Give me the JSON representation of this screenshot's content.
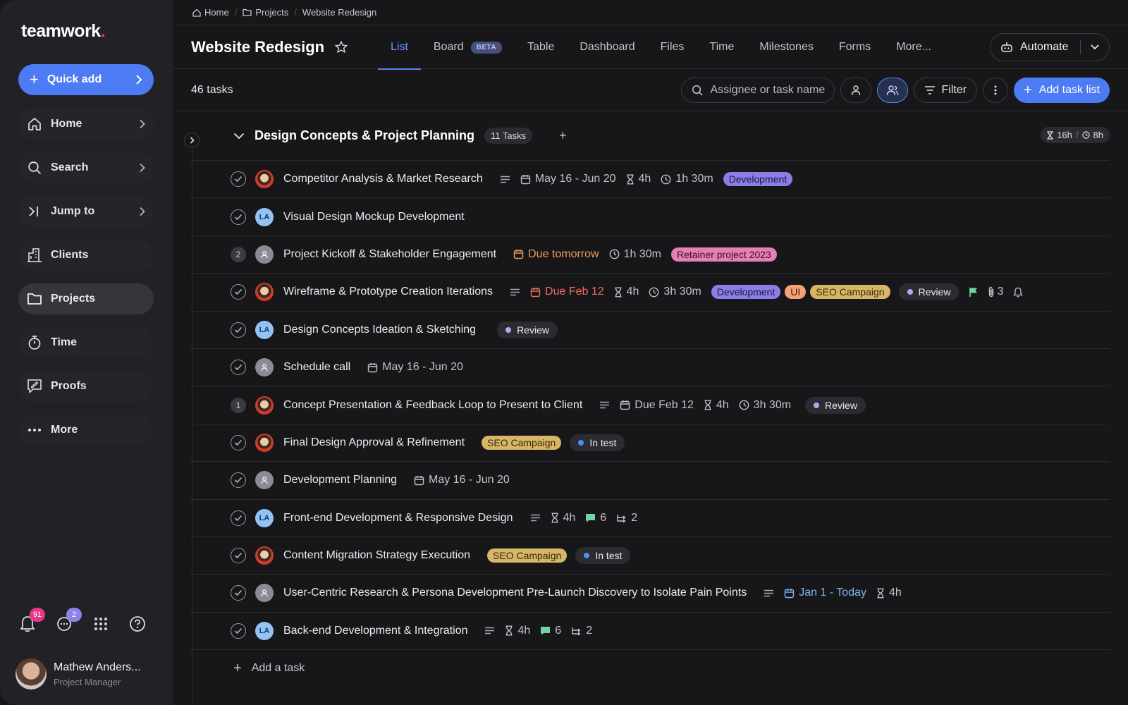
{
  "app": {
    "logo_text": "teamwork",
    "logo_dot": ".",
    "brand_color": "#4d7bf3"
  },
  "sidebar": {
    "quick_add_label": "Quick add",
    "items": [
      {
        "label": "Home",
        "icon": "home-icon",
        "has_chevron": true,
        "active": false
      },
      {
        "label": "Search",
        "icon": "search-icon",
        "has_chevron": true,
        "active": false
      },
      {
        "label": "Jump to",
        "icon": "jump-icon",
        "has_chevron": true,
        "active": false
      },
      {
        "label": "Clients",
        "icon": "building-icon",
        "has_chevron": false,
        "active": false
      },
      {
        "label": "Projects",
        "icon": "folder-icon",
        "has_chevron": false,
        "active": true
      },
      {
        "label": "Time",
        "icon": "stopwatch-icon",
        "has_chevron": false,
        "active": false
      },
      {
        "label": "Proofs",
        "icon": "proof-icon",
        "has_chevron": false,
        "active": false
      },
      {
        "label": "More",
        "icon": "more-dots-icon",
        "has_chevron": false,
        "active": false
      }
    ],
    "notifications_count": "91",
    "chat_count": "2",
    "user": {
      "name": "Mathew Anders...",
      "role": "Project Manager"
    }
  },
  "breadcrumb": {
    "home": "Home",
    "projects": "Projects",
    "current": "Website Redesign"
  },
  "header": {
    "title": "Website Redesign",
    "tabs": [
      {
        "label": "List",
        "active": true
      },
      {
        "label": "Board",
        "badge": "BETA"
      },
      {
        "label": "Table"
      },
      {
        "label": "Dashboard"
      },
      {
        "label": "Files"
      },
      {
        "label": "Time"
      },
      {
        "label": "Milestones"
      },
      {
        "label": "Forms"
      },
      {
        "label": "More..."
      }
    ],
    "automate_label": "Automate"
  },
  "toolbar": {
    "task_count": "46 tasks",
    "search_placeholder": "Assignee or task name",
    "filter_label": "Filter",
    "add_task_list_label": "Add task list"
  },
  "group": {
    "title": "Design Concepts & Project Planning",
    "count_label": "11 Tasks",
    "estimated": "16h",
    "logged": "8h",
    "add_task_label": "Add a task"
  },
  "tasks": [
    {
      "name": "Competitor Analysis & Market Research",
      "avatar": "photo",
      "desc": true,
      "date": "May 16 - Jun 20",
      "estimate": "4h",
      "logged": "1h 30m",
      "tags": [
        "Development"
      ]
    },
    {
      "name": "Visual Design Mockup Development",
      "avatar": "LA"
    },
    {
      "name": "Project Kickoff & Stakeholder Engagement",
      "avatar": "generic",
      "subtasks": "2",
      "due": "Due tomorrow",
      "due_color": "orange",
      "logged": "1h 30m",
      "tags": [
        "Retainer project 2023"
      ]
    },
    {
      "name": "Wireframe & Prototype Creation Iterations",
      "avatar": "photo",
      "desc": true,
      "due": "Due Feb 12",
      "due_color": "red",
      "estimate": "4h",
      "logged": "3h 30m",
      "tags": [
        "Development",
        "UI",
        "SEO Campaign"
      ],
      "status": "Review",
      "flag": true,
      "attachments": "3",
      "reminder": true
    },
    {
      "name": "Design Concepts Ideation & Sketching",
      "avatar": "LA",
      "status": "Review"
    },
    {
      "name": "Schedule call",
      "avatar": "generic",
      "date": "May 16 - Jun 20"
    },
    {
      "name": "Concept Presentation & Feedback Loop to Present to Client",
      "avatar": "photo",
      "subtasks": "1",
      "desc": true,
      "due": "Due Feb 12",
      "due_color": "gray",
      "estimate": "4h",
      "logged": "3h 30m",
      "status": "Review"
    },
    {
      "name": "Final Design Approval & Refinement",
      "avatar": "photo",
      "tags": [
        "SEO Campaign"
      ],
      "status": "In test"
    },
    {
      "name": "Development Planning",
      "avatar": "generic",
      "date": "May 16 - Jun 20"
    },
    {
      "name": "Front-end Development & Responsive Design",
      "avatar": "LA",
      "desc": true,
      "estimate": "4h",
      "comments": "6",
      "dependencies": "2"
    },
    {
      "name": "Content Migration Strategy Execution",
      "avatar": "photo",
      "tags": [
        "SEO Campaign"
      ],
      "status": "In test"
    },
    {
      "name": "User-Centric Research & Persona Development Pre-Launch Discovery to Isolate Pain Points",
      "avatar": "generic",
      "desc": true,
      "due": "Jan 1 - Today",
      "due_color": "blue",
      "estimate": "4h"
    },
    {
      "name": "Back-end Development & Integration",
      "avatar": "LA",
      "desc": true,
      "estimate": "4h",
      "comments": "6",
      "dependencies": "2"
    }
  ],
  "colors": {
    "tag_development": "#8b7fe6",
    "tag_ui": "#f7a07a",
    "tag_seo": "#d8b667",
    "tag_retainer": "#e67fb6",
    "status_review": "#b4a8f5",
    "status_in_test": "#4d8ff5"
  }
}
